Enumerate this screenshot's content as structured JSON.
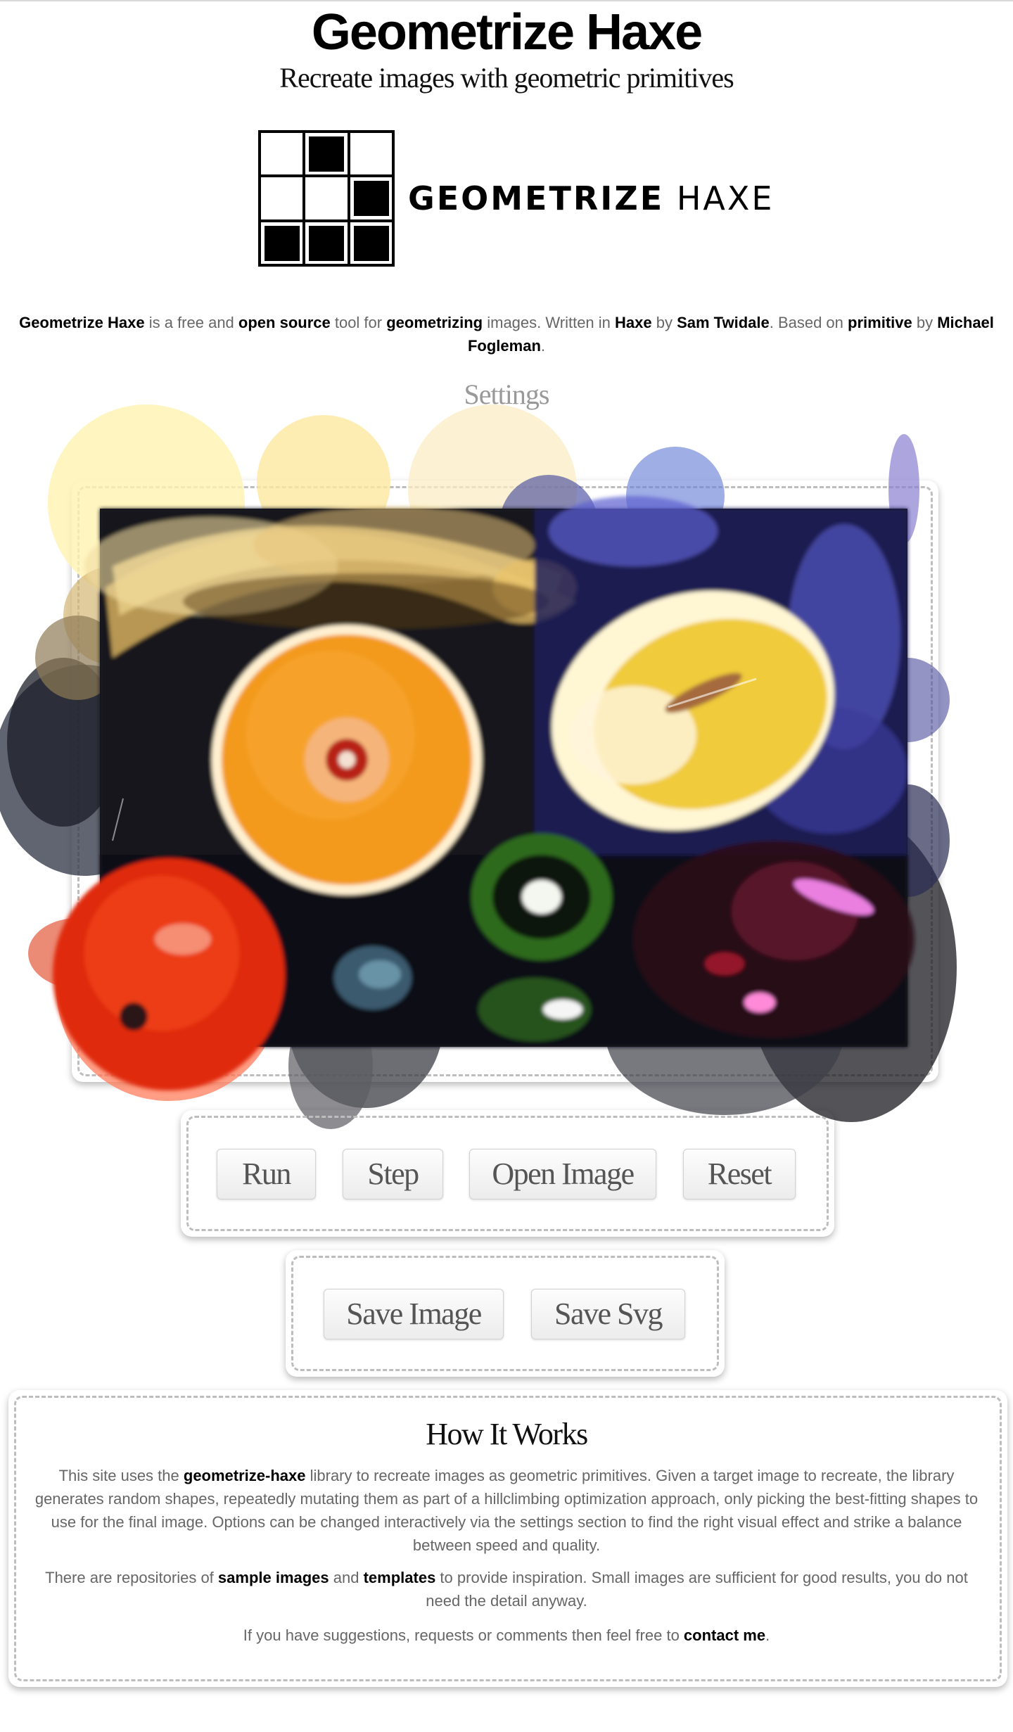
{
  "header": {
    "title": "Geometrize Haxe",
    "subtitle": "Recreate images with geometric primitives"
  },
  "logo": {
    "text_bold": "GEOMETRIZE",
    "text_regular": "HAXE"
  },
  "intro": {
    "name": "Geometrize Haxe",
    "t1": " is a free and ",
    "open_source": "open source",
    "t2": " tool for ",
    "geometrizing": "geometrizing",
    "t3": " images. Written in ",
    "haxe": "Haxe",
    "t4": " by ",
    "author": "Sam Twidale",
    "t5": ". Based on ",
    "primitive": "primitive",
    "t6": " by ",
    "primitive_author": "Michael Fogleman",
    "t7": "."
  },
  "settings_link": "Settings",
  "controls": {
    "run": "Run",
    "step": "Step",
    "open_image": "Open Image",
    "reset": "Reset",
    "save_image": "Save Image",
    "save_svg": "Save Svg"
  },
  "how_it_works": {
    "title": "How It Works",
    "p1_a": "This site uses the ",
    "p1_lib": "geometrize-haxe",
    "p1_b": " library to recreate images as geometric primitives. Given a target image to recreate, the library generates random shapes, repeatedly mutating them as part of a hillclimbing optimization approach, only picking the best-fitting shapes to use for the final image. Options can be changed interactively via the settings section to find the right visual effect and strike a balance between speed and quality.",
    "p2_a": "There are repositories of ",
    "p2_samples": "sample images",
    "p2_b": " and ",
    "p2_templates": "templates",
    "p2_c": " to provide inspiration. Small images are sufficient for good results, you do not need the detail anyway.",
    "p3_a": "If you have suggestions, requests or comments then feel free to ",
    "p3_contact": "contact me",
    "p3_b": "."
  },
  "colors": {
    "accent": "#000000",
    "text": "#666666",
    "muted": "#999999"
  },
  "icons": {
    "logo": "geometrize-grid-logo"
  }
}
